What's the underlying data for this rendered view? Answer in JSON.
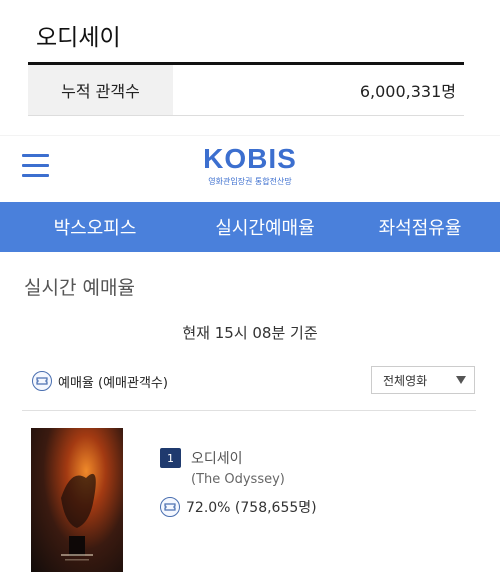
{
  "top_card": {
    "title": "오디세이",
    "stat_label": "누적 관객수",
    "stat_value": "6,000,331명"
  },
  "header": {
    "logo": "KOBIS",
    "logo_sub": "영화관입장권 통합전산망"
  },
  "nav": {
    "items": [
      "박스오피스",
      "실시간예매율",
      "좌석점유율"
    ]
  },
  "main": {
    "section_title": "실시간 예매율",
    "basis_text": "현재 15시 08분 기준",
    "rate_label": "예매율 (예매관객수)",
    "filter_selected": "전체영화",
    "movie": {
      "rank": "1",
      "title": "오디세이",
      "title_en": "(The Odyssey)",
      "rate": "72.0% (758,655명)"
    }
  },
  "colors": {
    "brand_blue": "#4a80db",
    "logo_blue": "#3c6fcf",
    "badge_navy": "#1f3a6e"
  }
}
